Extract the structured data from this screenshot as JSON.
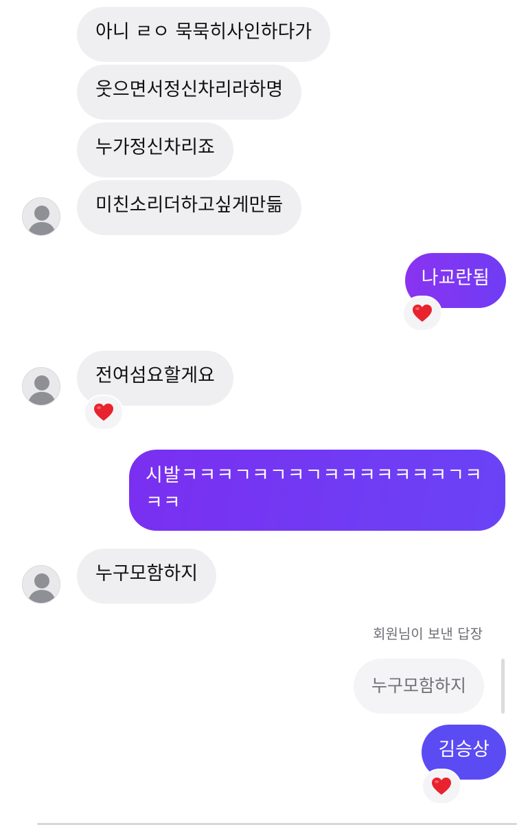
{
  "messages": {
    "m1": "아니 ㄹㅇ 묵묵히사인하다가",
    "m2": "웃으면서정신차리라하명",
    "m3": "누가정신차리죠",
    "m4": "미친소리더하고싶게만듦",
    "m5": "나교란됨",
    "m6": "전여섬요할게요",
    "m7": "시발ㅋㅋㅋㄱㅋㄱㅋㄱㅋㅋㅋㅋㅋㅋㅋㄱㅋㅋㅋ",
    "m8": "누구모함하지",
    "m9": "김승상"
  },
  "reply": {
    "label": "회원님이 보낸 답장",
    "quoted_text": "누구모함하지"
  },
  "reactions": {
    "emoji": "heart-icon",
    "color": "#e8232d"
  },
  "colors": {
    "incoming_bubble": "#efeff1",
    "outgoing_purple": "#8a33f0",
    "outgoing_blue": "#5b4bf3"
  }
}
